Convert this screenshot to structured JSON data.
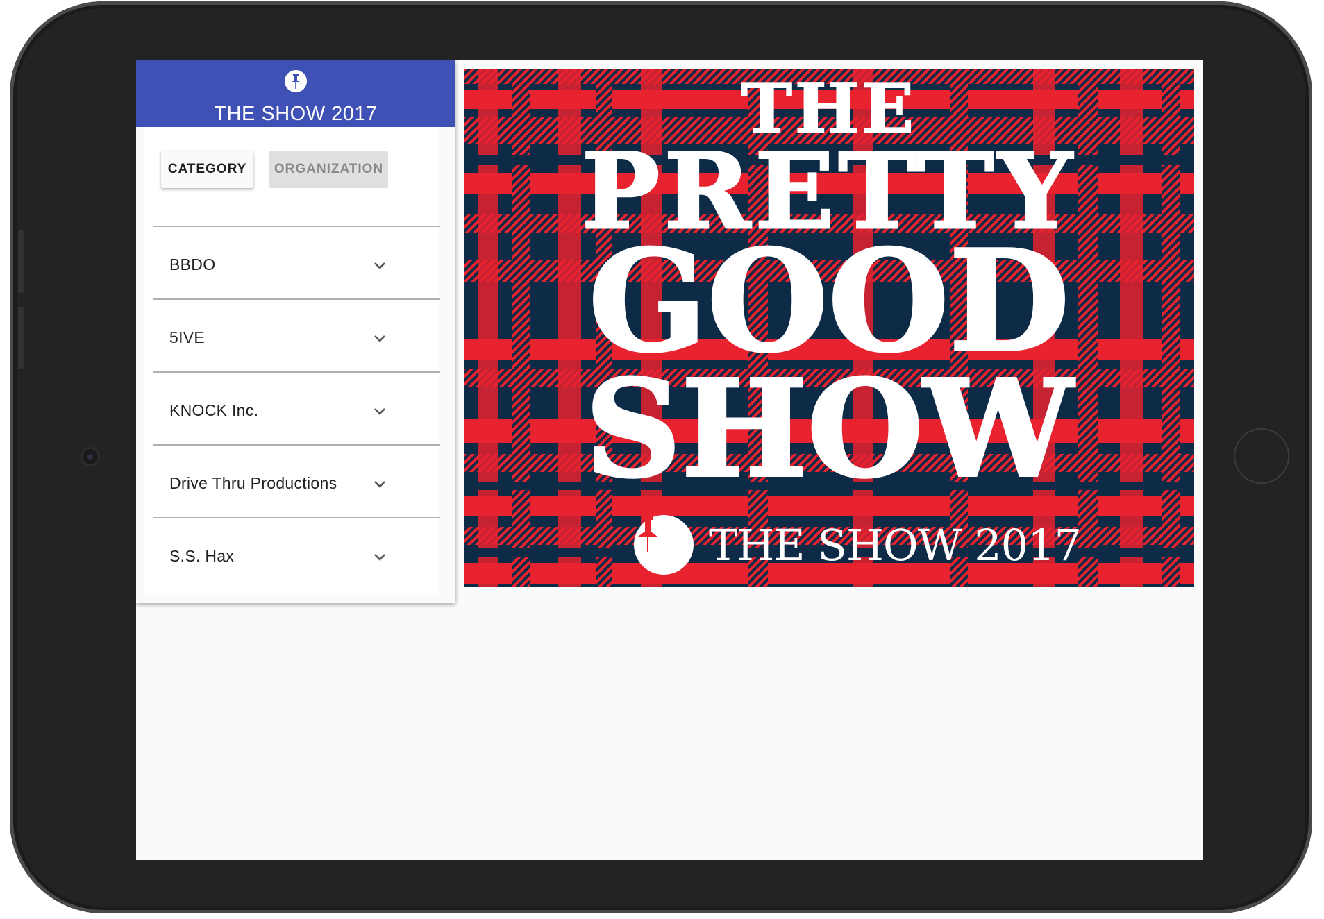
{
  "app": {
    "title": "THE SHOW 2017"
  },
  "tabs": {
    "category_label": "CATEGORY",
    "organization_label": "ORGANIZATION"
  },
  "organizations": [
    {
      "label": "BBDO"
    },
    {
      "label": "5IVE"
    },
    {
      "label": "KNOCK Inc."
    },
    {
      "label": "Drive Thru Productions"
    },
    {
      "label": "S.S. Hax"
    }
  ],
  "poster": {
    "line1": "THE",
    "line2": "PRETTY",
    "line3": "GOOD",
    "line4": "SHOW",
    "footer": "THE SHOW 2017"
  },
  "colors": {
    "header": "#3f51b5",
    "plaid_red": "#e8222f",
    "plaid_navy": "#0d2a47"
  },
  "icons": {
    "logo": "pushpin-icon",
    "expand": "chevron-down-icon"
  }
}
